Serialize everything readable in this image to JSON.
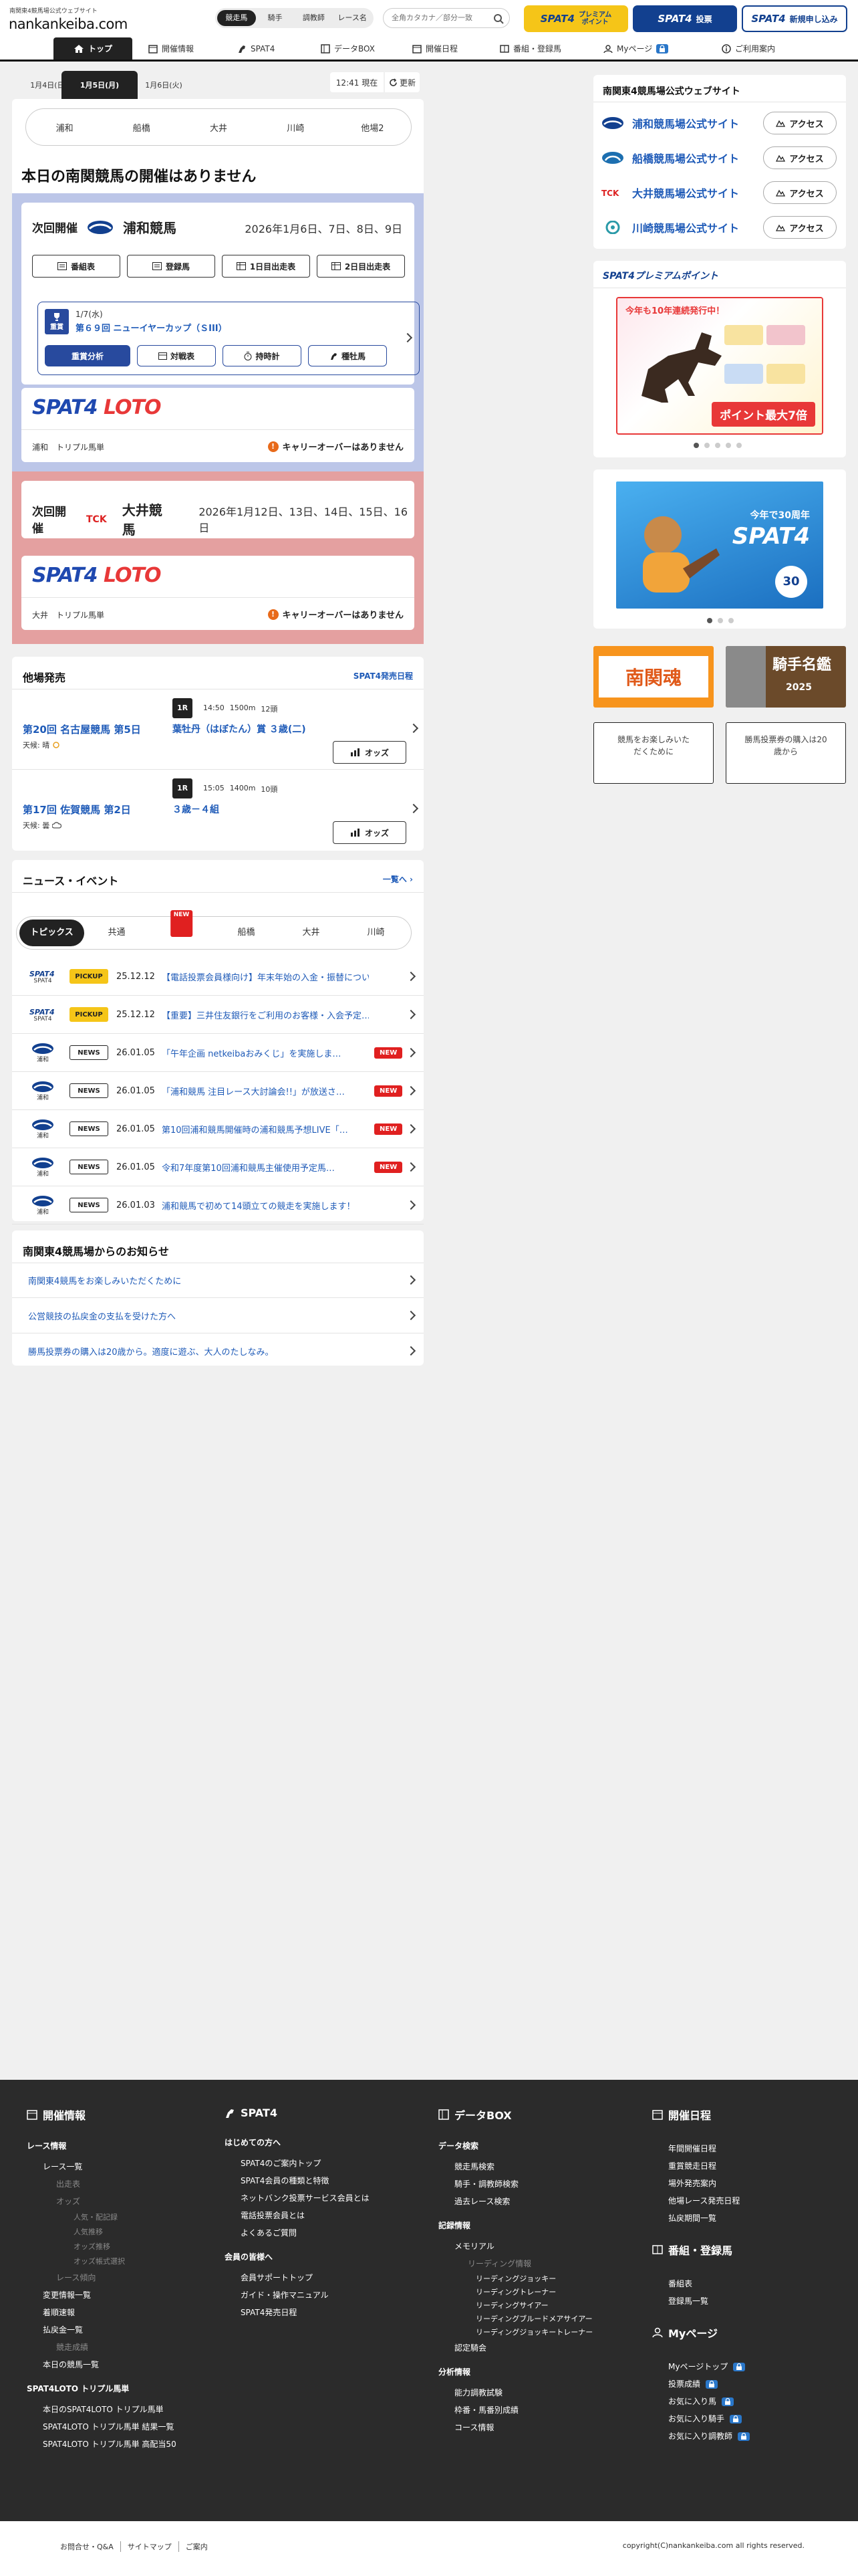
{
  "header": {
    "site_sub": "南関東4競馬場公式ウェブサイト",
    "site_name": "nankankeiba.com",
    "search_tabs": [
      "競走馬",
      "騎手",
      "調教師",
      "レース名"
    ],
    "search_placeholder": "全角カタカナ／部分一致",
    "btn_premium_brand": "SPAT4",
    "btn_premium_line1": "プレミアム",
    "btn_premium_line2": "ポイント",
    "btn_vote_brand": "SPAT4",
    "btn_vote_label": "投票",
    "btn_register_brand": "SPAT4",
    "btn_register_label": "新規申し込み"
  },
  "nav": [
    "トップ",
    "開催情報",
    "SPAT4",
    "データBOX",
    "開催日程",
    "番組・登録馬",
    "Myページ",
    "ご利用案内"
  ],
  "date_tabs": [
    "1月4日(日)",
    "1月5日(月)",
    "1月6日(火)"
  ],
  "time_now": "12:41 現在",
  "refresh": "更新",
  "venues": [
    "浦和",
    "船橋",
    "大井",
    "川崎",
    "他場2"
  ],
  "no_race_title": "本日の南関競馬の開催はありません",
  "next1": {
    "label": "次回開催",
    "venue": "浦和競馬",
    "dates": "2026年1月6日、7日、8日、9日",
    "buttons": [
      "番組表",
      "登録馬",
      "1日目出走表",
      "2日目出走表"
    ],
    "slide_date": "1/7(水)",
    "slide_grade": "重賞",
    "slide_race": "第６９回 ニューイヤーカップ（ＳIII）",
    "slide_buttons": [
      "重賞分析",
      "対戦表",
      "持時計",
      "種牡馬"
    ]
  },
  "loto1": {
    "brand1": "SPAT4",
    "brand2": "LOTO",
    "left": "浦和　トリプル馬単",
    "carry": "キャリーオーバーはありません"
  },
  "next2": {
    "label": "次回開催",
    "venue": "大井競馬",
    "dates": "2026年1月12日、13日、14日、15日、16日"
  },
  "loto2": {
    "brand1": "SPAT4",
    "brand2": "LOTO",
    "left": "大井　トリプル馬単",
    "carry": "キャリーオーバーはありません"
  },
  "other_venue": {
    "title": "他場発売",
    "link": "SPAT4発売日程",
    "races": [
      {
        "r": "1R",
        "time": "14:50",
        "dist": "1500m",
        "heads": "12頭",
        "meet": "第20回 名古屋競馬 第5日",
        "weather": "天候: 晴",
        "race": "葉牡丹（はぼたん）賞 ３歳(二)",
        "odds": "オッズ"
      },
      {
        "r": "1R",
        "time": "15:05",
        "dist": "1400m",
        "heads": "10頭",
        "meet": "第17回 佐賀競馬 第2日",
        "weather": "天候: 曇",
        "race": "３歳－４組",
        "odds": "オッズ"
      }
    ]
  },
  "news": {
    "title": "ニュース・イベント",
    "more": "一覧へ",
    "tabs": [
      "トピックス",
      "共通",
      "浦和",
      "船橋",
      "大井",
      "川崎"
    ],
    "new_tab_badge": "NEW",
    "items": [
      {
        "src": "SPAT4",
        "tag": "PICKUP",
        "date": "25.12.12",
        "text": "【電話投票会員様向け】年末年始の入金・振替につい…",
        "new": ""
      },
      {
        "src": "SPAT4",
        "tag": "PICKUP",
        "date": "25.12.12",
        "text": "【重要】三井住友銀行をご利用のお客様・入会予定…",
        "new": ""
      },
      {
        "src": "浦和",
        "tag": "NEWS",
        "date": "26.01.05",
        "text": "「午年企画 netkeibaおみくじ」を実施しま…",
        "new": "NEW"
      },
      {
        "src": "浦和",
        "tag": "NEWS",
        "date": "26.01.05",
        "text": "「浦和競馬 注目レース大討論会!!」が放送さ…",
        "new": "NEW"
      },
      {
        "src": "浦和",
        "tag": "NEWS",
        "date": "26.01.05",
        "text": "第10回浦和競馬開催時の浦和競馬予想LIVE「…",
        "new": "NEW"
      },
      {
        "src": "浦和",
        "tag": "NEWS",
        "date": "26.01.05",
        "text": "令和7年度第10回浦和競馬主催使用予定馬…",
        "new": "NEW"
      },
      {
        "src": "浦和",
        "tag": "NEWS",
        "date": "26.01.03",
        "text": "浦和競馬で初めて14頭立ての競走を実施します！",
        "new": ""
      }
    ]
  },
  "info": {
    "title": "南関東4競馬場からのお知らせ",
    "items": [
      "南関東4競馬をお楽しみいただくために",
      "公営競技の払戻金の支払を受けた方へ",
      "勝馬投票券の購入は20歳から。適度に遊ぶ、大人のたしなみ。"
    ]
  },
  "side": {
    "title": "南関東4競馬場公式ウェブサイト",
    "sites": [
      "浦和競馬場公式サイト",
      "船橋競馬場公式サイト",
      "大井競馬場公式サイト",
      "川崎競馬場公式サイト"
    ],
    "access": "アクセス",
    "premium_title": "SPAT4プレミアムポイント",
    "premium_banner_top": "今年も10年連続発行中！",
    "premium_banner_bot": "ポイント最大7倍",
    "spat4_banner": "今年で30周年",
    "spat4_banner_sub": "SPAT4",
    "banner_nankan": "南関魂",
    "banner_kishu": "騎手名鑑",
    "banner_year": "2025",
    "gray1": "競馬をお楽しみいただくために",
    "gray2": "勝馬投票券の購入は20歳から"
  },
  "footer": {
    "col1_head": "開催情報",
    "col1_sub1": "レース情報",
    "col1": [
      "レース一覧"
    ],
    "col1_gray": [
      "出走表",
      "オッズ"
    ],
    "col1_gray2": [
      "人気・配記録",
      "人気推移",
      "オッズ推移",
      "オッズ帳式選択"
    ],
    "col1_gray3": [
      "レース傾向"
    ],
    "col1b": [
      "変更情報一覧",
      "着順速報",
      "払戻金一覧"
    ],
    "col1_gray4": [
      "競走成績"
    ],
    "col1c": [
      "本日の競馬一覧"
    ],
    "col1_sub2": "SPAT4LOTO トリプル馬単",
    "col1d": [
      "本日のSPAT4LOTO トリプル馬単",
      "SPAT4LOTO トリプル馬単 結果一覧",
      "SPAT4LOTO トリプル馬単 高配当50"
    ],
    "col2_head": "SPAT4",
    "col2_sub1": "はじめての方へ",
    "col2a": [
      "SPAT4のご案内トップ",
      "SPAT4会員の種類と特徴",
      "ネットバンク投票サービス会員とは",
      "電話投票会員とは",
      "よくあるご質問"
    ],
    "col2_sub2": "会員の皆様へ",
    "col2b": [
      "会員サポートトップ",
      "ガイド・操作マニュアル",
      "SPAT4発売日程"
    ],
    "col3_head": "データBOX",
    "col3_sub1": "データ検索",
    "col3a": [
      "競走馬検索",
      "騎手・調教師検索",
      "過去レース検索"
    ],
    "col3_sub2": "記録情報",
    "col3b": [
      "メモリアル"
    ],
    "col3_gray": [
      "リーディング情報"
    ],
    "col3c": [
      "リーディングジョッキー",
      "リーディングトレーナー",
      "リーディングサイアー",
      "リーディングブルードメアサイアー",
      "リーディングジョッキートレーナー"
    ],
    "col3d": [
      "認定騎会"
    ],
    "col3_sub3": "分析情報",
    "col3e": [
      "能力調教試験",
      "枠番・馬番別成績",
      "コース情報"
    ],
    "col4_head": "開催日程",
    "col4a": [
      "年間開催日程",
      "重賞競走日程",
      "場外発売案内",
      "他場レース発売日程",
      "払戻期間一覧"
    ],
    "col4_head2": "番組・登録馬",
    "col4b": [
      "番組表",
      "登録馬一覧"
    ],
    "col4_head3": "Myページ",
    "col4c": [
      "Myページトップ",
      "投票成績",
      "お気に入り馬",
      "お気に入り騎手",
      "お気に入り調教師"
    ]
  },
  "bottom": {
    "links": [
      "お問合せ・Q&A",
      "サイトマップ",
      "ご案内"
    ],
    "copyright": "copyright(C)nankankeiba.com all rights reserved."
  },
  "colors": {
    "accent_blue": "#1f5bb8",
    "premium_yellow": "#f5c518",
    "brand_navy": "#12408f",
    "urawa_bg": "#bcc6e8",
    "oi_bg": "#e4a0a0",
    "new_red": "#e02020"
  }
}
